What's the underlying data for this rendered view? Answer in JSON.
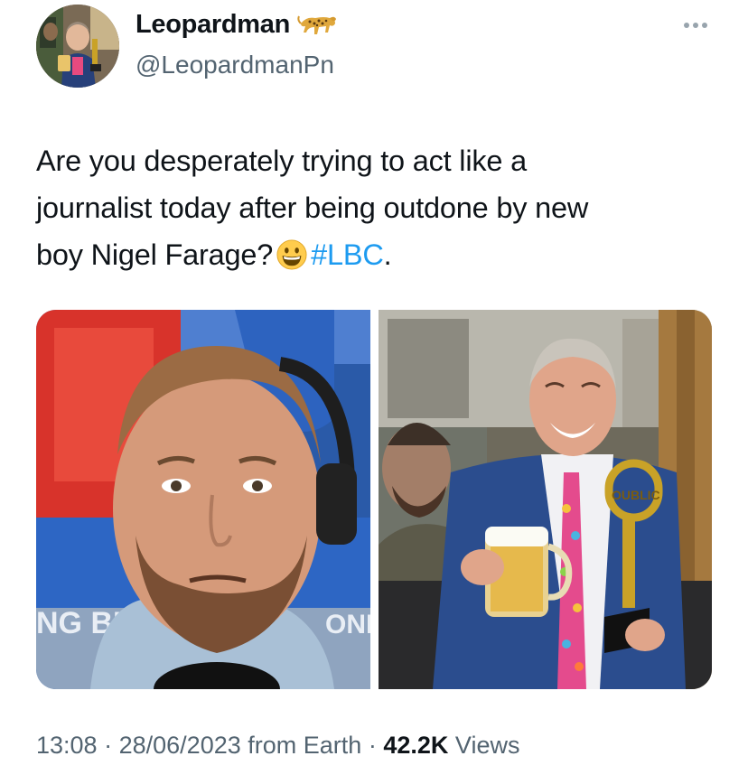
{
  "author": {
    "display_name": "Leopardman",
    "handle": "@LeopardmanPn",
    "badge_icon": "leopard-emoji"
  },
  "tweet": {
    "line1": "Are you desperately trying to act like a",
    "line2": "journalist today after being outdone by new",
    "line3_prefix": "boy Nigel Farage?",
    "emoji": "grinning-face-emoji",
    "hashtag": "#LBC",
    "suffix": "."
  },
  "media": {
    "photo_left": {
      "sign_text": "NG BR",
      "sign_text_right": "ONI"
    },
    "photo_right": {
      "award_text": "OUBLIC"
    }
  },
  "meta": {
    "time": "13:08",
    "separator": "·",
    "date": "28/06/2023",
    "source": "from Earth",
    "views_count": "42.2K",
    "views_label": "Views"
  },
  "colors": {
    "text": "#0f1419",
    "secondary": "#536471",
    "link": "#1d9bf0"
  }
}
